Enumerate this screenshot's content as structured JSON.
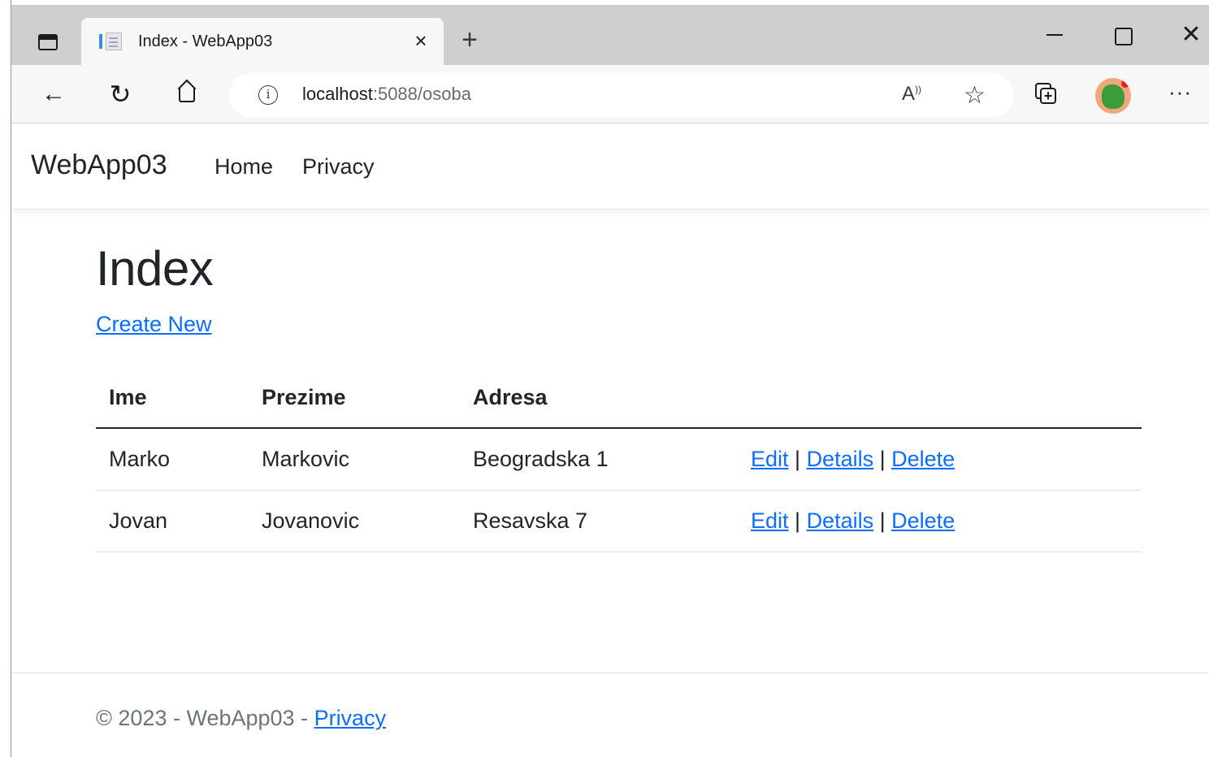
{
  "browser": {
    "tab_title": "Index - WebApp03",
    "tab_close": "×",
    "new_tab": "+",
    "url_host": "localhost",
    "url_rest": ":5088/osoba",
    "info_glyph": "i",
    "read_aloud_glyph": "A",
    "fav_glyph": "☆",
    "more_glyph": "···",
    "back_glyph": "←",
    "refresh_glyph": "↻",
    "close_glyph": "✕"
  },
  "navbar": {
    "brand": "WebApp03",
    "links": [
      "Home",
      "Privacy"
    ]
  },
  "main": {
    "title": "Index",
    "create_link": "Create New",
    "table": {
      "headers": [
        "Ime",
        "Prezime",
        "Adresa",
        ""
      ],
      "rows": [
        {
          "ime": "Marko",
          "prezime": "Markovic",
          "adresa": "Beogradska 1"
        },
        {
          "ime": "Jovan",
          "prezime": "Jovanovic",
          "adresa": "Resavska 7"
        }
      ],
      "actions": {
        "edit": "Edit",
        "details": "Details",
        "delete": "Delete",
        "separator": "|"
      }
    }
  },
  "footer": {
    "text": "© 2023 - WebApp03 - ",
    "link": "Privacy"
  },
  "colors": {
    "link": "#0d6efd",
    "text": "#212529",
    "muted": "#6c757d",
    "tabstrip": "#cfcfcf",
    "toolbar": "#f7f7f7"
  }
}
